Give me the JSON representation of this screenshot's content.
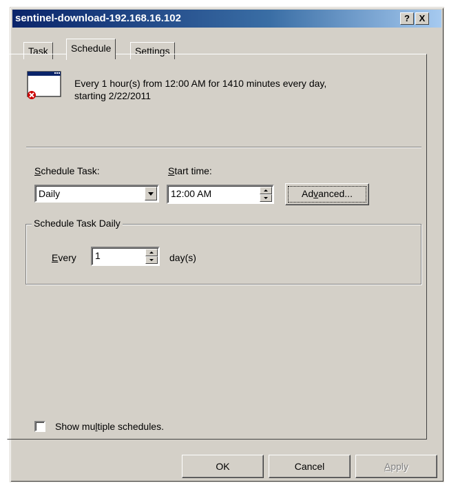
{
  "window": {
    "title": "sentinel-download-192.168.16.102",
    "help_button": "?",
    "close_button": "X"
  },
  "tabs": [
    {
      "label": "Task",
      "active": false
    },
    {
      "label": "Schedule",
      "active": true
    },
    {
      "label": "Settings",
      "active": false
    }
  ],
  "summary": {
    "line1": "Every 1 hour(s) from 12:00 AM for 1410 minutes every day,",
    "line2": "starting 2/22/2011",
    "icon": "scheduled-task-error-icon"
  },
  "schedule_task": {
    "label_prefix": "",
    "label_access": "S",
    "label_rest": "chedule Task:",
    "value": "Daily"
  },
  "start_time": {
    "label_access": "S",
    "label_rest": "tart time:",
    "value": "12:00 AM"
  },
  "advanced_button": {
    "pre": "Ad",
    "access": "v",
    "post": "anced..."
  },
  "group": {
    "title": "Schedule Task Daily",
    "every_access": "E",
    "every_rest": "very",
    "every_value": "1",
    "unit": "day(s)"
  },
  "show_multiple": {
    "pre": "Show mu",
    "access": "l",
    "post": "tiple schedules.",
    "checked": false
  },
  "buttons": {
    "ok": "OK",
    "cancel": "Cancel",
    "apply_access": "A",
    "apply_rest": "pply"
  },
  "colors": {
    "dialog_face": "#d4d0c8",
    "title_start": "#0a246a",
    "title_end": "#a6caf0",
    "error_badge": "#cc0000"
  }
}
